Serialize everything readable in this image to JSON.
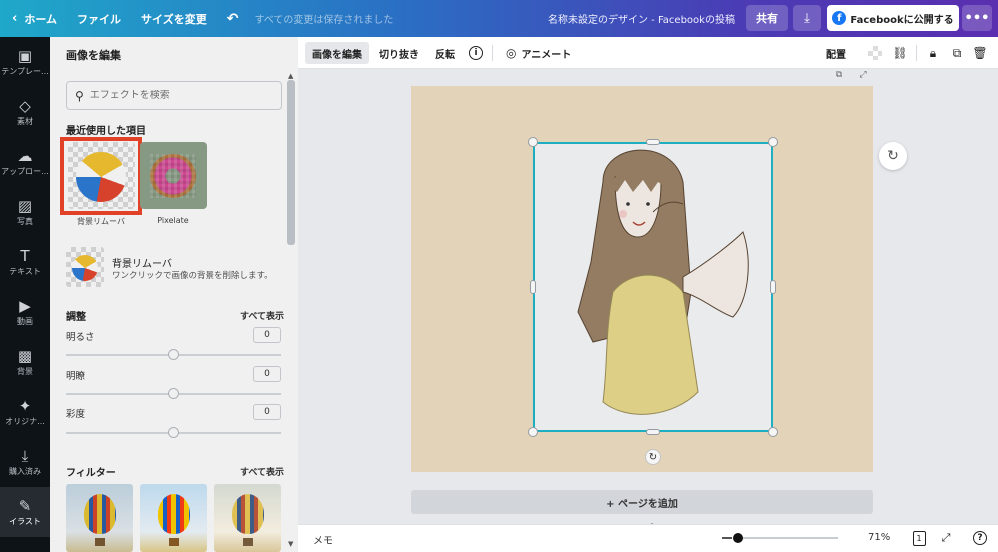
{
  "topbar": {
    "home": "ホーム",
    "file": "ファイル",
    "resize": "サイズを変更",
    "status": "すべての変更は保存されました",
    "title": "名称未設定のデザイン - Facebookの投稿",
    "share": "共有",
    "publish": "Facebookに公開する",
    "fb_icon": "f"
  },
  "rail": [
    {
      "icon": "▣",
      "label": "テンプレー..."
    },
    {
      "icon": "◇",
      "label": "素材"
    },
    {
      "icon": "☁",
      "label": "アップロー..."
    },
    {
      "icon": "▨",
      "label": "写真"
    },
    {
      "icon": "T",
      "label": "テキスト"
    },
    {
      "icon": "▶",
      "label": "動画"
    },
    {
      "icon": "▩",
      "label": "背景"
    },
    {
      "icon": "✦",
      "label": "オリジナ..."
    },
    {
      "icon": "⤓",
      "label": "購入済み"
    },
    {
      "icon": "✎",
      "label": "イラスト"
    }
  ],
  "panel": {
    "header": "画像を編集",
    "search_placeholder": "エフェクトを検索",
    "recent_title": "最近使用した項目",
    "recent": [
      {
        "label": "背景リムーバ"
      },
      {
        "label": "Pixelate"
      }
    ],
    "feature": {
      "name": "背景リムーバ",
      "desc": "ワンクリックで画像の背景を削除します。"
    },
    "adjust_title": "調整",
    "show_all": "すべて表示",
    "adjust": [
      {
        "label": "明るさ",
        "value": "0",
        "level": 0.5
      },
      {
        "label": "明瞭",
        "value": "0",
        "level": 0.5
      },
      {
        "label": "彩度",
        "value": "0",
        "level": 0.5
      }
    ],
    "filter_title": "フィルター",
    "filter_show_all": "すべて表示"
  },
  "ctx": {
    "edit_image": "画像を編集",
    "crop": "切り抜き",
    "flip": "反転",
    "info": "i",
    "animate": "アニメート",
    "arrange": "配置"
  },
  "canvas": {
    "add_page": "+ ページを追加",
    "page_colors": {
      "page": "#eddcc0",
      "selection": "#1fb7c9"
    }
  },
  "bottom": {
    "memo": "メモ",
    "zoom": "71%",
    "zoom_level": 0.71,
    "page_num": "1",
    "help": "?"
  }
}
